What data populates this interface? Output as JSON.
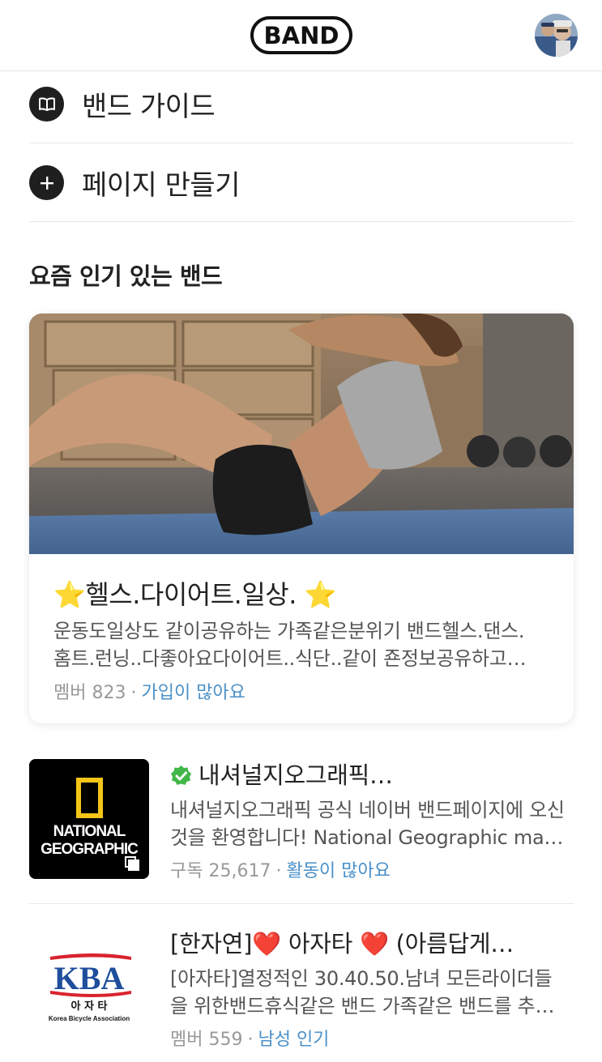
{
  "header": {
    "logo_text": "BAND",
    "avatar_alt": "profile"
  },
  "menu": [
    {
      "label": "밴드 가이드",
      "icon": "book-icon"
    },
    {
      "label": "페이지 만들기",
      "icon": "plus-icon"
    }
  ],
  "popular": {
    "section_title": "요즘 인기 있는 밴드",
    "featured": {
      "title": "⭐헬스.다이어트.일상. ⭐",
      "desc_line1": "운동도일상도 같이공유하는 가족같은분위기 밴드헬스.댄스.",
      "desc_line2": "홈트.런닝..다좋아요다이어트..식단..같이 죤정보공유하고…",
      "meta_prefix": "멤버 823",
      "meta_highlight": "가입이 많아요"
    },
    "list": [
      {
        "title": "내셔널지오그래픽…",
        "desc_line1": "내셔널지오그래픽 공식 네이버 밴드페이지에 오신",
        "desc_line2": "것을 환영합니다! National Geographic ma…",
        "meta_prefix": "구독 25,617",
        "meta_highlight": "활동이 많아요",
        "thumb_text1": "NATIONAL",
        "thumb_text2": "GEOGRAPHIC",
        "verified": true
      },
      {
        "title": "[한자연]❤️ 아자타 ❤️  (아름답게…",
        "desc_line1": "[아자타]열정적인 30.40.50.남녀 모든라이더들",
        "desc_line2": "을 위한밴드휴식같은 밴드 가족같은 밴드를 추…",
        "meta_prefix": "멤버 559",
        "meta_highlight": "남성 인기",
        "thumb_text1": "KBA",
        "thumb_text2": "아 자 타",
        "thumb_text3": "Korea Bicycle Association"
      }
    ]
  },
  "colors": {
    "highlight": "#4a90c8",
    "verified": "#43b649",
    "natgeo_yellow": "#f5c518",
    "kba_red": "#d9232e",
    "kba_blue": "#1f4e9c"
  }
}
